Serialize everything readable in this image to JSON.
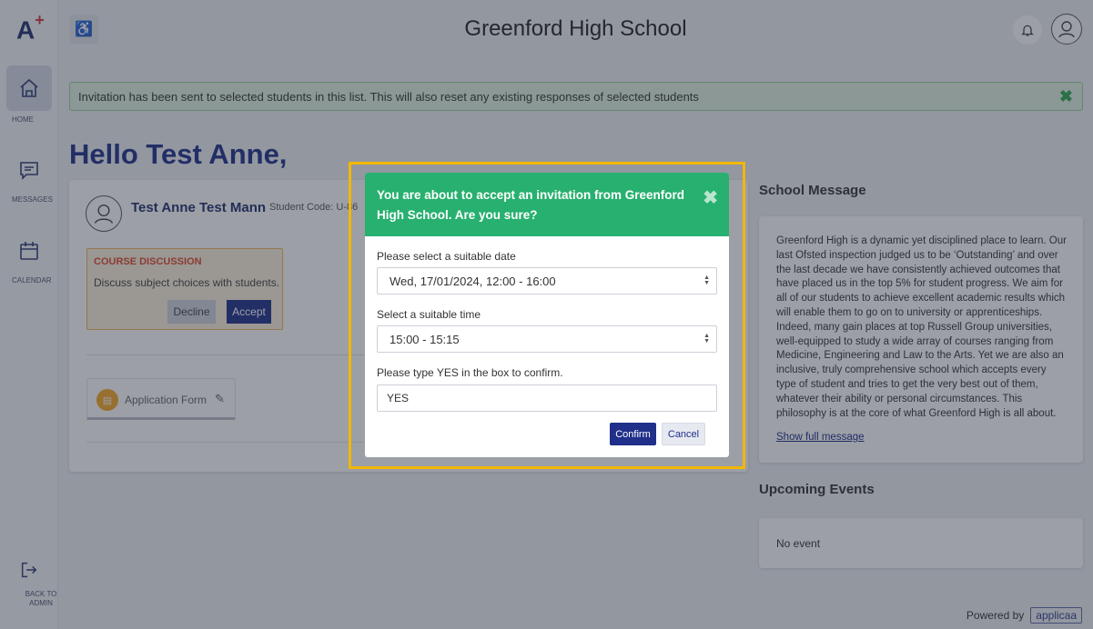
{
  "app": {
    "logo_letter": "A",
    "logo_plus": "+",
    "school_name": "Greenford High School"
  },
  "sidebar": {
    "items": [
      {
        "label": "HOME",
        "icon": "home-icon",
        "active": true
      },
      {
        "label": "MESSAGES",
        "icon": "messages-icon"
      },
      {
        "label": "CALENDAR",
        "icon": "calendar-icon"
      }
    ],
    "back_label": "BACK TO ADMIN"
  },
  "alert": {
    "text": "Invitation has been sent to selected students in this list. This will also reset any existing responses of selected students",
    "close": "✖"
  },
  "greeting": "Hello Test Anne,",
  "student": {
    "name": "Test Anne Test Mann",
    "code_label": "Student Code: U-86",
    "course": {
      "title": "COURSE DISCUSSION",
      "description": "Discuss subject choices with students.",
      "decline": "Decline",
      "accept": "Accept"
    },
    "application_form": "Application Form"
  },
  "school_message": {
    "title": "School Message",
    "body": "Greenford High is a dynamic yet disciplined place to learn. Our last Ofsted inspection judged us to be ‘Outstanding’ and over the last decade we have consistently achieved outcomes that have placed us in the top 5% for student progress. We aim for all of our students to achieve excellent academic results which will enable them to go on to university or apprenticeships. Indeed, many gain places at top Russell Group universities, well-equipped to study a wide array of courses ranging from Medicine, Engineering and Law to the Arts. Yet we are also an inclusive, truly comprehensive school which accepts every type of student and tries to get the very best out of them, whatever their ability or personal circumstances. This philosophy is at the core of what Greenford High is all about.",
    "show_full": "Show full message"
  },
  "events": {
    "title": "Upcoming Events",
    "empty": "No event"
  },
  "footer": {
    "powered_by": "Powered by",
    "brand": "applicaa"
  },
  "modal": {
    "title": "You are about to accept an invitation from Greenford High School. Are you sure?",
    "close": "✖",
    "date_label": "Please select a suitable date",
    "date_value": "Wed, 17/01/2024, 12:00 - 16:00",
    "time_label": "Select a suitable time",
    "time_value": "15:00 - 15:15",
    "confirm_label": "Please type YES in the box to confirm.",
    "confirm_value": "YES",
    "confirm_button": "Confirm",
    "cancel_button": "Cancel"
  },
  "colors": {
    "brand_navy": "#1f2f8a",
    "modal_header": "#27b06f",
    "highlight": "#f2b705",
    "alert_bg": "#dff3df"
  }
}
